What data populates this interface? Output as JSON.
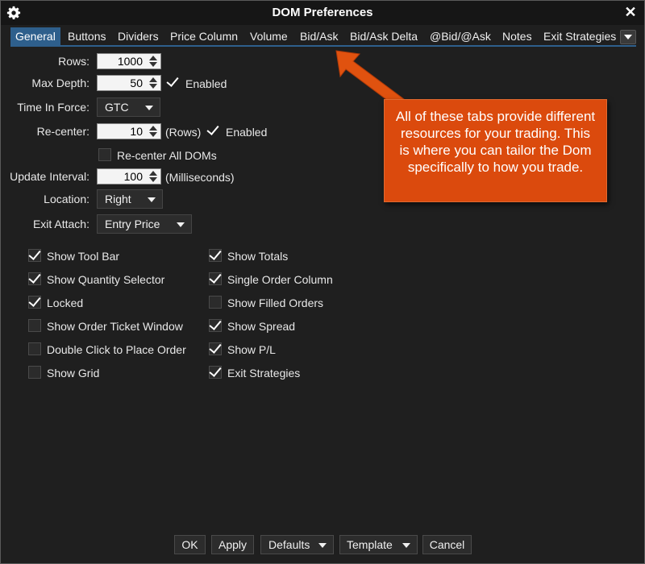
{
  "window": {
    "title": "DOM Preferences"
  },
  "tabs": [
    "General",
    "Buttons",
    "Dividers",
    "Price Column",
    "Volume",
    "Bid/Ask",
    "Bid/Ask Delta",
    "@Bid/@Ask",
    "Notes",
    "Exit Strategies"
  ],
  "general": {
    "rows": {
      "label": "Rows:",
      "value": "1000"
    },
    "max_depth": {
      "label": "Max Depth:",
      "value": "50",
      "enabled_label": "Enabled"
    },
    "time_in_force": {
      "label": "Time In Force:",
      "value": "GTC"
    },
    "recenter": {
      "label": "Re-center:",
      "value": "10",
      "unit": "(Rows)",
      "enabled_label": "Enabled"
    },
    "recenter_all": {
      "label": "Re-center All DOMs"
    },
    "update_interval": {
      "label": "Update Interval:",
      "value": "100",
      "unit": "(Milliseconds)"
    },
    "location": {
      "label": "Location:",
      "value": "Right"
    },
    "exit_attach": {
      "label": "Exit Attach:",
      "value": "Entry Price"
    }
  },
  "checkboxes_left": [
    {
      "label": "Show Tool Bar",
      "checked": true
    },
    {
      "label": "Show Quantity Selector",
      "checked": true
    },
    {
      "label": "Locked",
      "checked": true
    },
    {
      "label": "Show Order Ticket Window",
      "checked": false
    },
    {
      "label": "Double Click to Place Order",
      "checked": false
    },
    {
      "label": "Show Grid",
      "checked": false
    }
  ],
  "checkboxes_right": [
    {
      "label": "Show Totals",
      "checked": true
    },
    {
      "label": "Single Order Column",
      "checked": true
    },
    {
      "label": "Show Filled Orders",
      "checked": false
    },
    {
      "label": "Show Spread",
      "checked": true
    },
    {
      "label": "Show P/L",
      "checked": true
    },
    {
      "label": "Exit Strategies",
      "checked": true
    }
  ],
  "buttons": {
    "ok": "OK",
    "apply": "Apply",
    "defaults": "Defaults",
    "template": "Template",
    "cancel": "Cancel"
  },
  "callout": {
    "text": "All of these tabs provide different resources for your trading. This is where you can tailor the Dom specifically to how you trade."
  },
  "colors": {
    "accent": "#2e5f8c",
    "callout": "#db4a0d",
    "background": "#1f1f1f"
  }
}
